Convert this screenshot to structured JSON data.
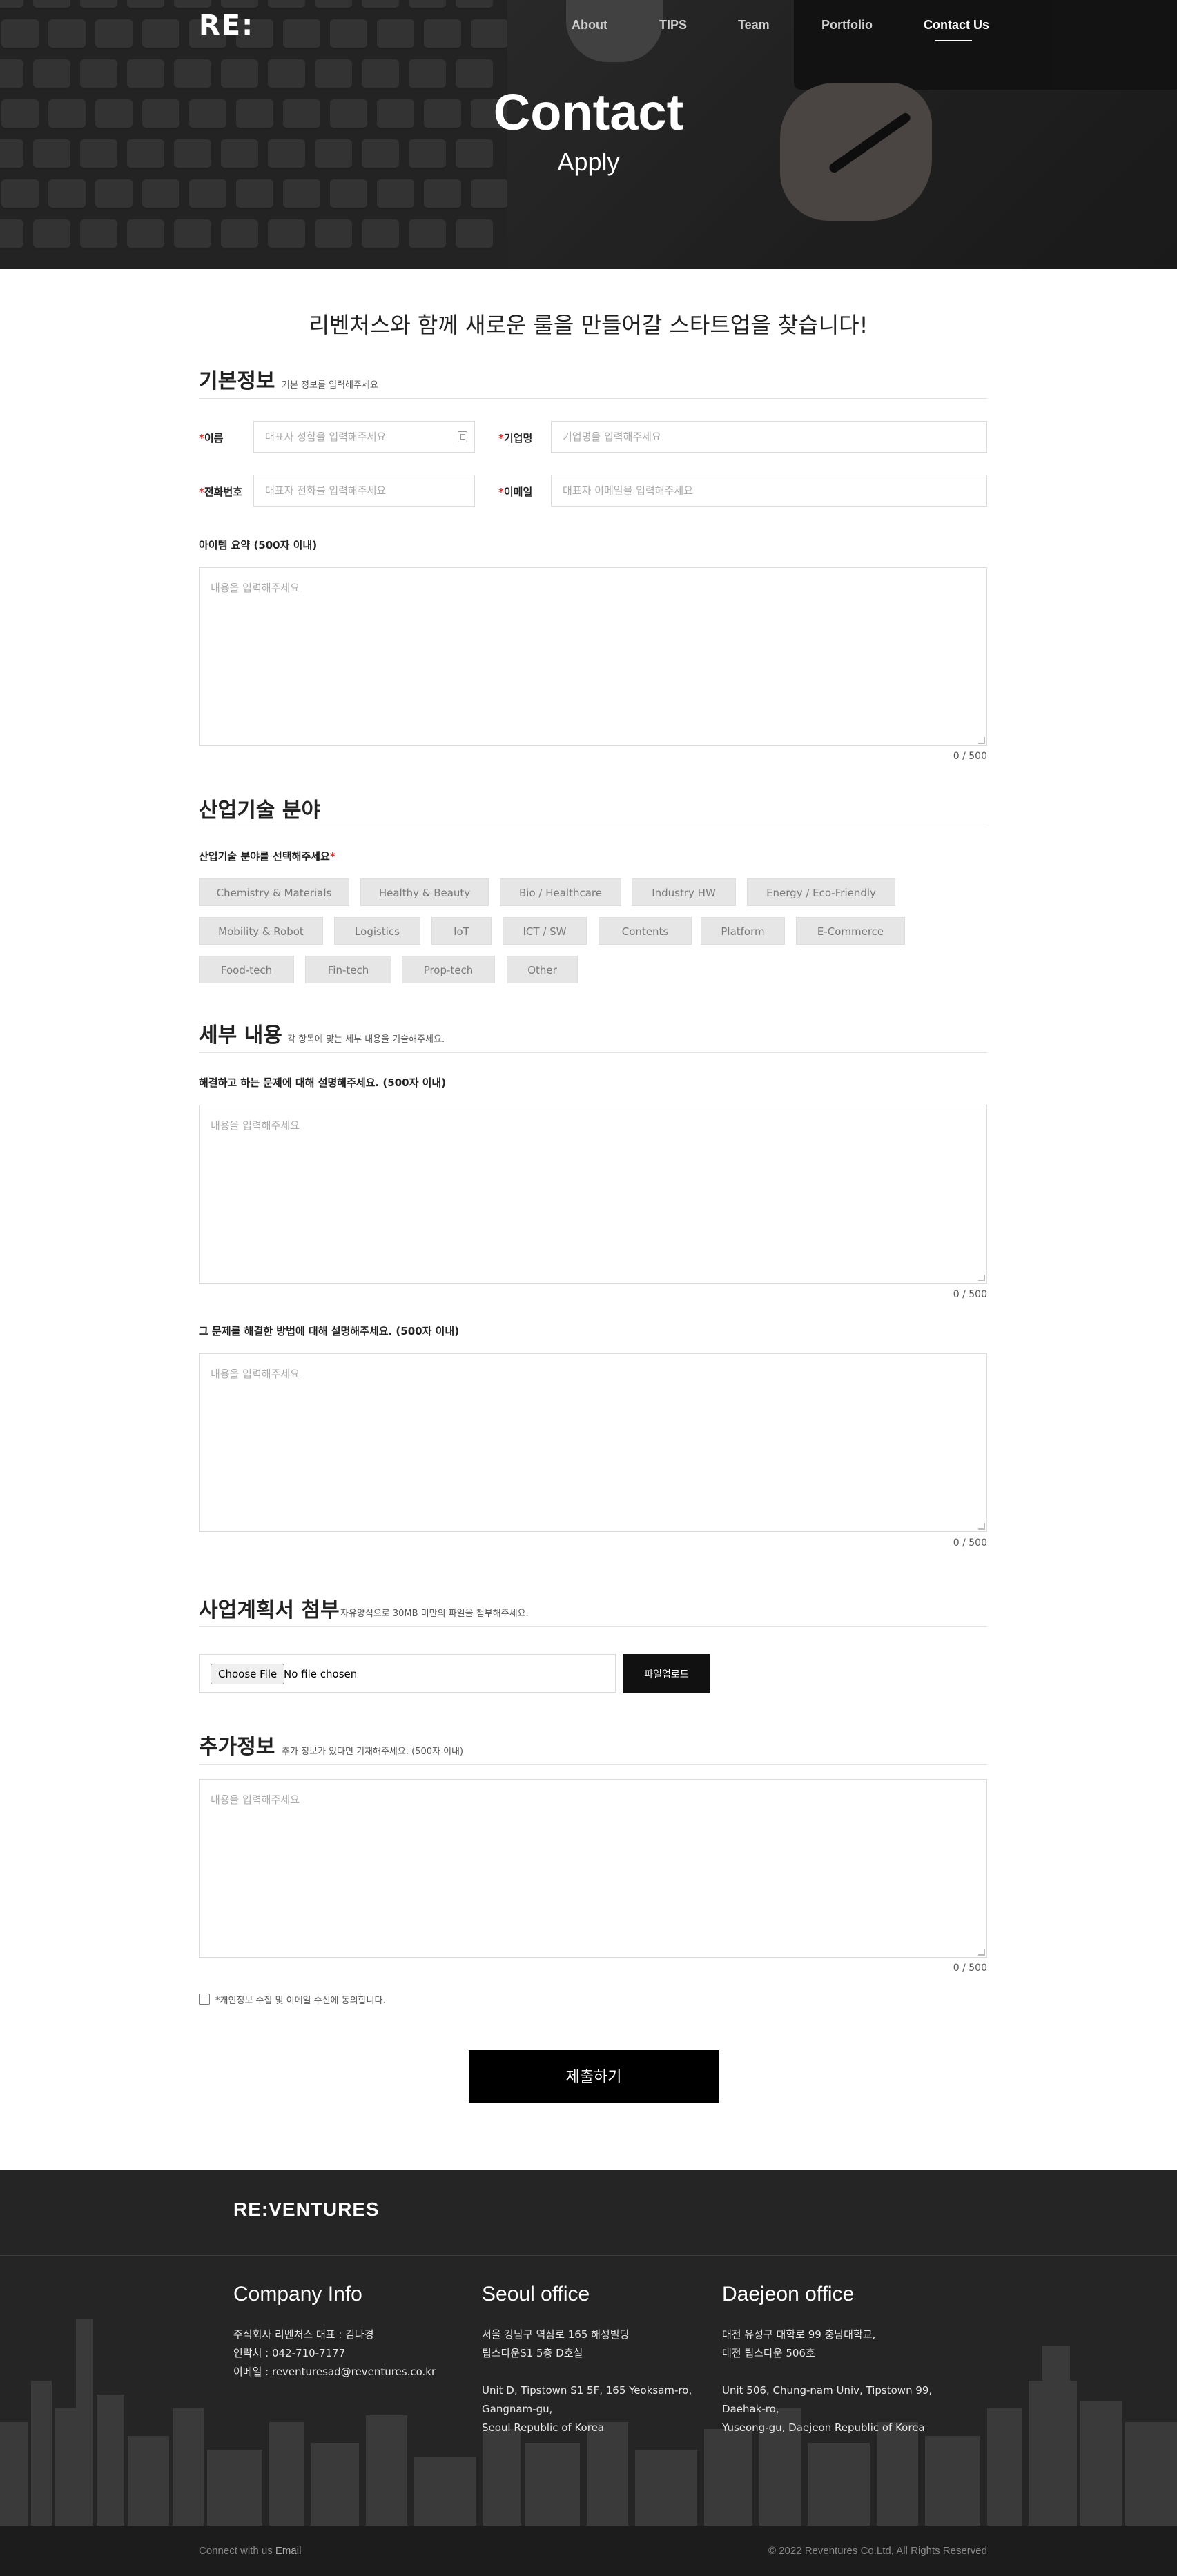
{
  "brand": {
    "logo": "RE:"
  },
  "nav": {
    "items": [
      {
        "label": "About"
      },
      {
        "label": "TIPS"
      },
      {
        "label": "Team"
      },
      {
        "label": "Portfolio"
      },
      {
        "label": "Contact Us"
      }
    ]
  },
  "hero": {
    "title": "Contact",
    "subtitle": "Apply"
  },
  "tagline": "리벤처스와 함께 새로운 룰을 만들어갈 스타트업을 찾습니다!",
  "basic_info": {
    "title": "기본정보",
    "desc": "기본 정보를 입력해주세요",
    "name_label": "이름",
    "name_placeholder": "대표자 성함을 입력해주세요",
    "company_label": "기업명",
    "company_placeholder": "기업명을 입력해주세요",
    "phone_label": "전화번호",
    "phone_placeholder": "대표자 전화를 입력해주세요",
    "email_label": "이메일",
    "email_placeholder": "대표자 이메일을 입력해주세요",
    "required_mark": "*",
    "summary_label": "아이템 요약 (500자 이내)",
    "summary_placeholder": "내용을 입력해주세요",
    "summary_counter": "0 / 500"
  },
  "industry": {
    "title": "산업기술 분야",
    "select_label": "산업기술 분야를 선택해주세요",
    "required_mark": "*",
    "chips": [
      "Chemistry & Materials",
      "Healthy & Beauty",
      "Bio / Healthcare",
      "Industry HW",
      "Energy / Eco-Friendly",
      "Mobility & Robot",
      "Logistics",
      "IoT",
      "ICT / SW",
      "Contents",
      "Platform",
      "E-Commerce",
      "Food-tech",
      "Fin-tech",
      "Prop-tech",
      "Other"
    ]
  },
  "details": {
    "title": "세부 내용",
    "desc": "각 항목에 맞는 세부 내용을 기술해주세요.",
    "problem_label": "해결하고 하는 문제에 대해 설명해주세요. (500자 이내)",
    "problem_placeholder": "내용을 입력해주세요",
    "problem_counter": "0 / 500",
    "solution_label": "그 문제를 해결한 방법에 대해 설명해주세요. (500자 이내)",
    "solution_placeholder": "내용을 입력해주세요",
    "solution_counter": "0 / 500"
  },
  "attachment": {
    "title": "사업계획서 첨부",
    "desc": "자유양식으로 30MB 미만의 파일을 첨부해주세요.",
    "choose_label": "Choose File",
    "file_status": "No file chosen",
    "upload_label": "파일업로드"
  },
  "extra": {
    "title": "추가정보",
    "desc": "추가 정보가 있다면 기재해주세요. (500자 이내)",
    "placeholder": "내용을 입력해주세요",
    "counter": "0 / 500"
  },
  "consent": {
    "label": "*개인정보 수집 및 이메일 수신에 동의합니다."
  },
  "submit": {
    "label": "제출하기"
  },
  "footer": {
    "logo": "RE:VENTURES",
    "company": {
      "title": "Company Info",
      "lines": [
        "주식회사 리벤처스 대표 : 김나경",
        "연락처 : 042-710-7177",
        "이메일 : reventuresad@reventures.co.kr"
      ]
    },
    "seoul": {
      "title": "Seoul office",
      "lines": [
        "서울 강남구 역삼로 165 해성빌딩",
        "팁스타운S1 5층 D호실",
        "",
        "Unit D, Tipstown S1 5F, 165 Yeoksam-ro,",
        "Gangnam-gu,",
        "Seoul Republic of Korea"
      ]
    },
    "daejeon": {
      "title": "Daejeon office",
      "lines": [
        "대전 유성구 대학로 99 충남대학교,",
        "대전 팁스타운 506호",
        "",
        "Unit 506, Chung-nam Univ, Tipstown 99,",
        "Daehak-ro,",
        "Yuseong-gu, Daejeon Republic of Korea"
      ]
    },
    "connect_prefix": "Connect with us",
    "connect_link": "Email",
    "copyright": "© 2022 Reventures Co.Ltd, All Rights Reserved"
  }
}
